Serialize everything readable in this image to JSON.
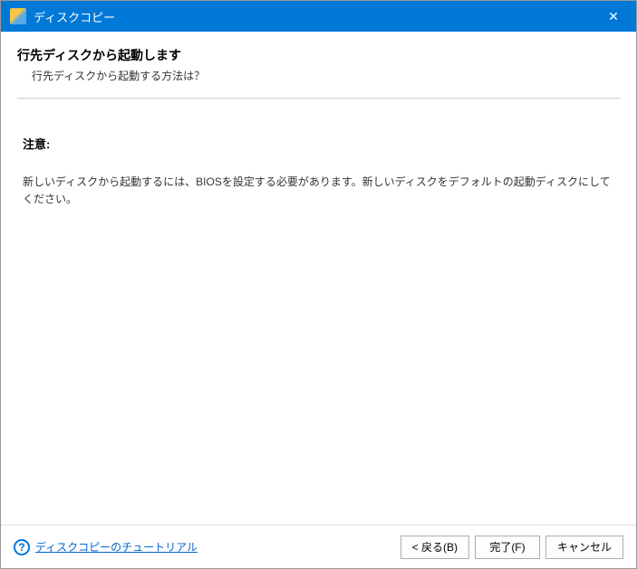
{
  "titlebar": {
    "title": "ディスクコピー",
    "close_symbol": "✕"
  },
  "main": {
    "heading": "行先ディスクから起動します",
    "subheading": "行先ディスクから起動する方法は？",
    "note_label": "注意:",
    "note_text": "新しいディスクから起動するには、BIOSを設定する必要があります。新しいディスクをデフォルトの起動ディスクにしてください。"
  },
  "footer": {
    "help_symbol": "?",
    "tutorial_link": "ディスクコピーのチュートリアル",
    "back_label": "< 戻る(B)",
    "finish_label": "完了(F)",
    "cancel_label": "キャンセル"
  }
}
